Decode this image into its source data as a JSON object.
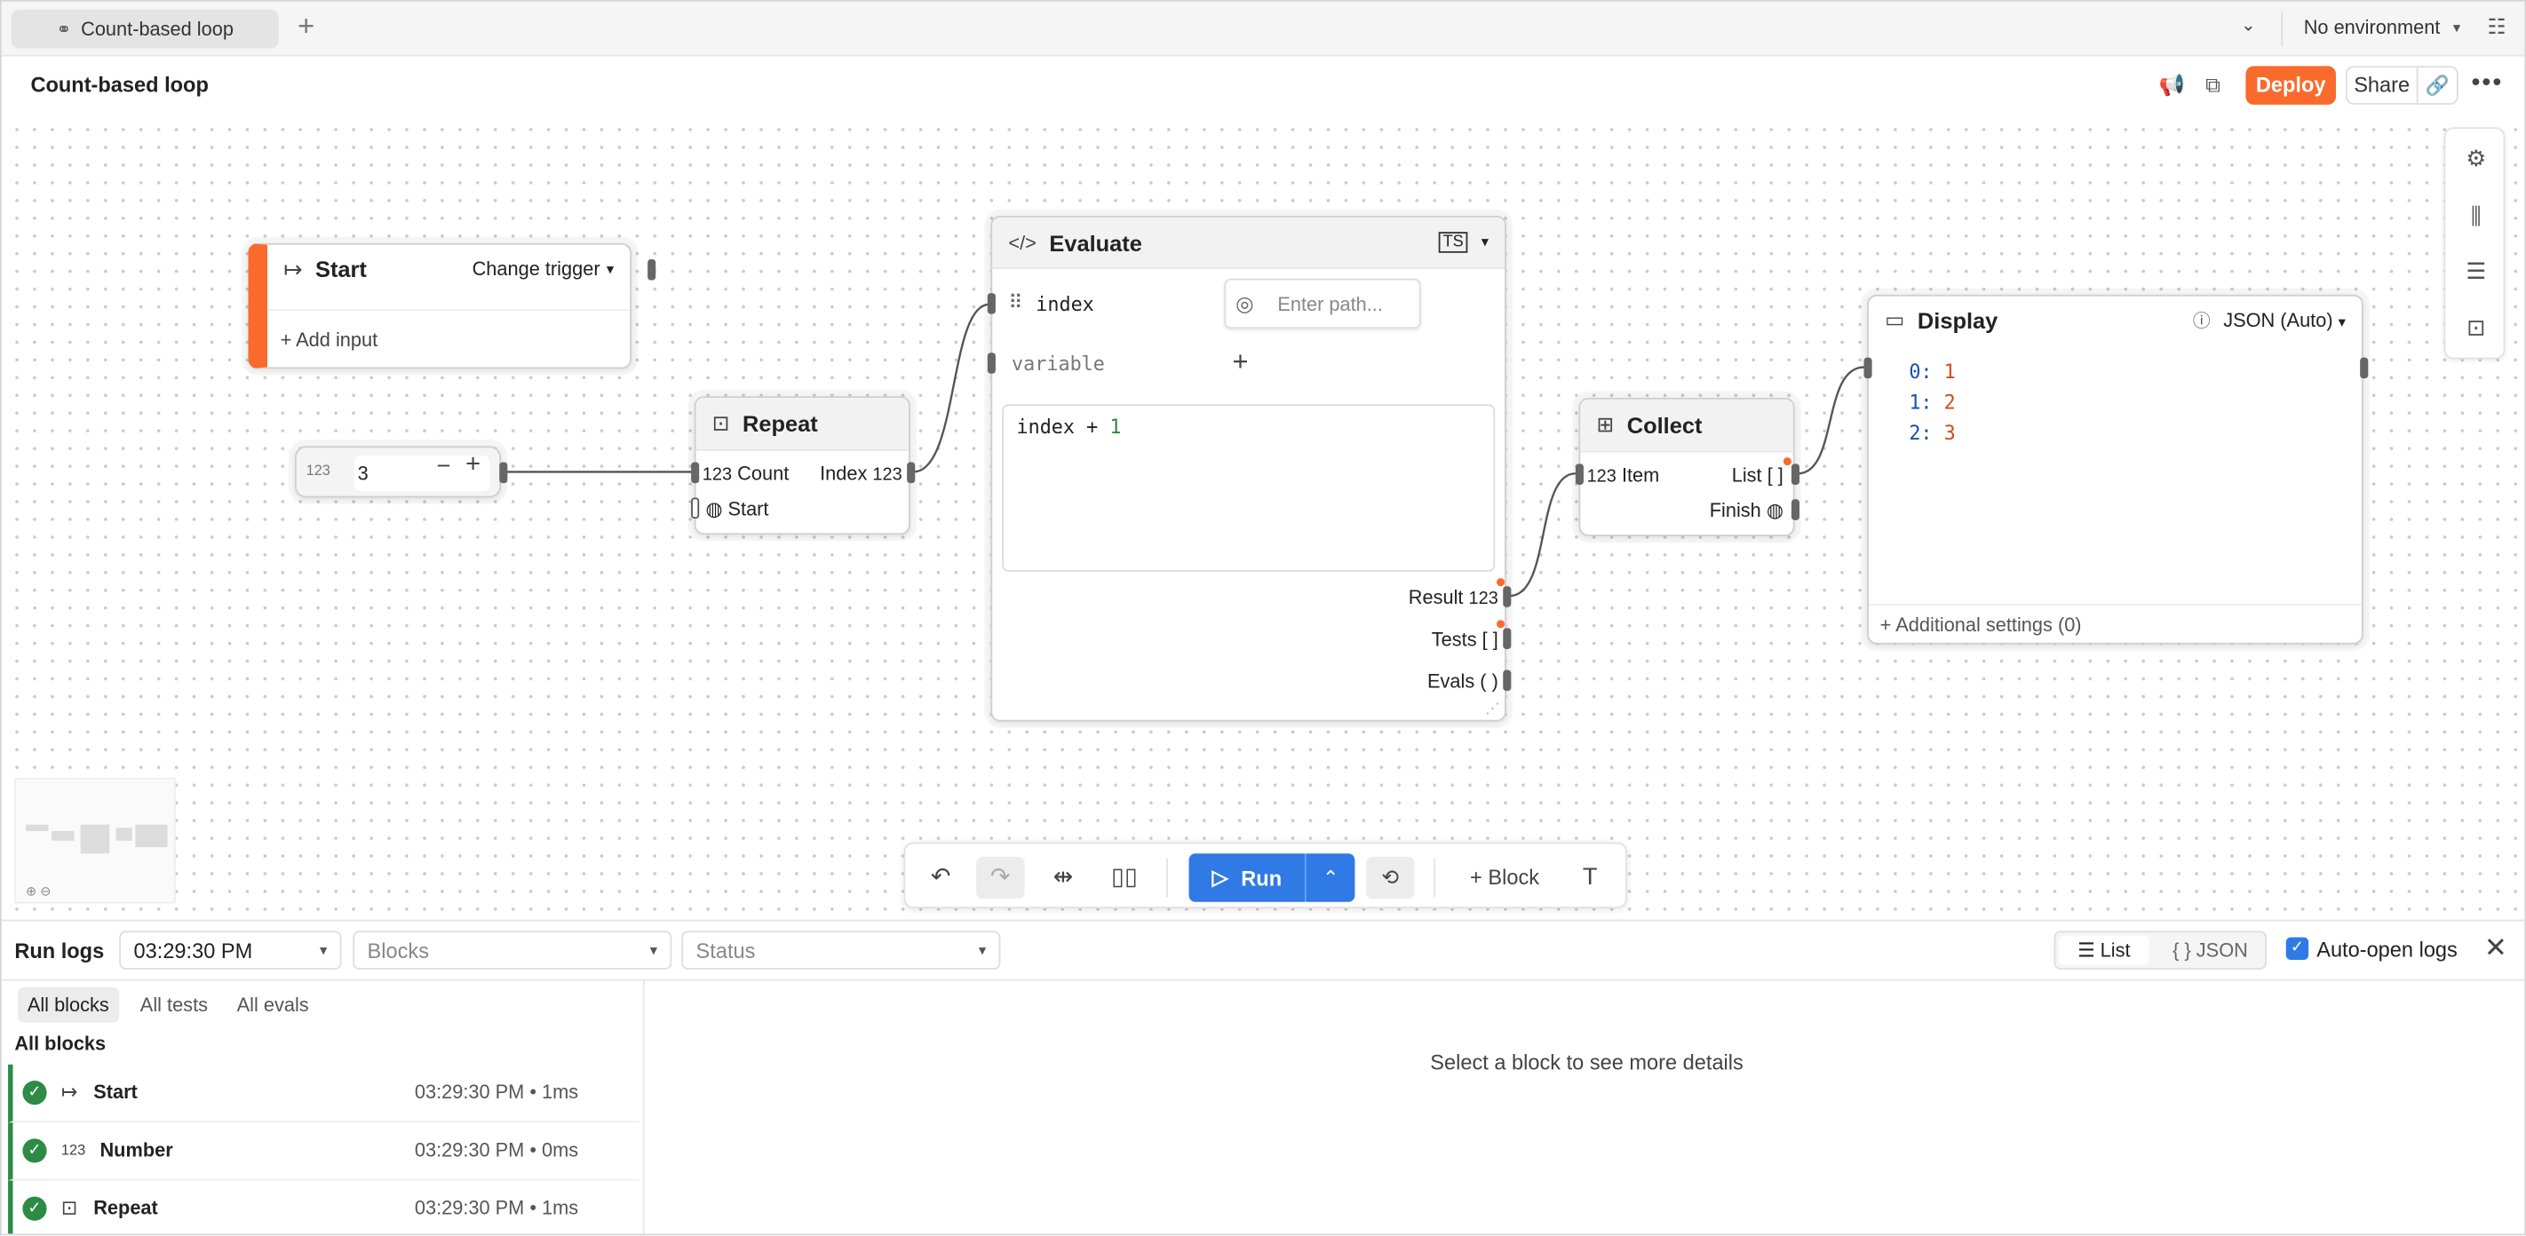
{
  "tabbar": {
    "tab_label": "Count-based loop",
    "add_tab": "+",
    "environment": "No environment"
  },
  "header": {
    "title": "Count-based loop",
    "deploy": "Deploy",
    "share": "Share"
  },
  "nodes": {
    "start": {
      "title": "Start",
      "trigger": "Change trigger",
      "add_input": "Add input"
    },
    "number": {
      "tag": "123",
      "value": "3"
    },
    "repeat": {
      "title": "Repeat",
      "count_label": "Count",
      "index_label": "Index",
      "start_label": "Start",
      "num_icon": "123"
    },
    "evaluate": {
      "title": "Evaluate",
      "lang_badge": "TS",
      "input1": "index",
      "input2": "variable",
      "path_placeholder": "Enter path...",
      "code_prefix": "index + ",
      "code_number": "1",
      "out_result": "Result",
      "out_tests": "Tests",
      "out_evals": "Evals",
      "num_icon": "123",
      "list_icon": "[ ]",
      "evals_icon": "( )"
    },
    "collect": {
      "title": "Collect",
      "item_label": "Item",
      "list_label": "List",
      "finish_label": "Finish",
      "num_icon": "123",
      "list_icon": "[ ]"
    },
    "display": {
      "title": "Display",
      "mode": "JSON (Auto)",
      "rows": [
        {
          "key": "0:",
          "value": "1"
        },
        {
          "key": "1:",
          "value": "2"
        },
        {
          "key": "2:",
          "value": "3"
        }
      ],
      "additional": "Additional settings (0)"
    }
  },
  "toolbar": {
    "run": "Run",
    "block": "Block"
  },
  "logs": {
    "title": "Run logs",
    "time_filter": "03:29:30 PM",
    "blocks_placeholder": "Blocks",
    "status_placeholder": "Status",
    "view_list": "List",
    "view_json": "{ } JSON",
    "auto_open": "Auto-open logs",
    "subtabs": [
      "All blocks",
      "All tests",
      "All evals"
    ],
    "section": "All blocks",
    "rows": [
      {
        "icon": "↦",
        "name": "Start",
        "meta": "03:29:30 PM • 1ms"
      },
      {
        "icon": "123",
        "name": "Number",
        "meta": "03:29:30 PM • 0ms"
      },
      {
        "icon": "⊡",
        "name": "Repeat",
        "meta": "03:29:30 PM • 1ms"
      }
    ],
    "detail_empty": "Select a block to see more details"
  },
  "colors": {
    "accent": "#f96b2c",
    "run": "#2f7ae5",
    "success": "#2e8b45"
  }
}
